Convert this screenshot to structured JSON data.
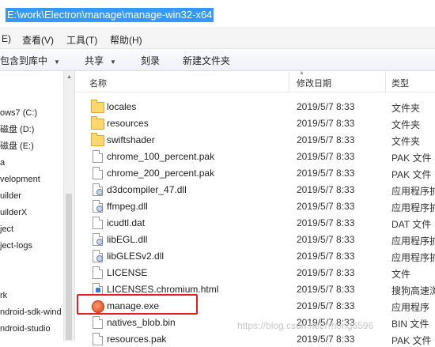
{
  "address_bar": {
    "path": "E:\\work\\Electron\\manage\\manage-win32-x64"
  },
  "menu": [
    {
      "label": "E)"
    },
    {
      "label": "查看(V)"
    },
    {
      "label": "工具(T)"
    },
    {
      "label": "帮助(H)"
    }
  ],
  "toolbar": {
    "include_library": "包含到库中",
    "share": "共享",
    "burn": "刻录",
    "new_folder": "新建文件夹"
  },
  "nav": {
    "items": [
      "ows7 (C:)",
      "磁盘 (D:)",
      "磁盘 (E:)",
      "a",
      "velopment",
      "uilder",
      "uilderX",
      "ject",
      "ject-logs",
      "rk",
      "ndroid-sdk-wind",
      "ndroid-studio"
    ]
  },
  "columns": {
    "name": "名称",
    "modified": "修改日期",
    "type": "类型"
  },
  "files": [
    {
      "name": "locales",
      "date": "2019/5/7 8:33",
      "type": "文件夹",
      "icon": "folder-icon"
    },
    {
      "name": "resources",
      "date": "2019/5/7 8:33",
      "type": "文件夹",
      "icon": "folder-icon"
    },
    {
      "name": "swiftshader",
      "date": "2019/5/7 8:33",
      "type": "文件夹",
      "icon": "folder-icon"
    },
    {
      "name": "chrome_100_percent.pak",
      "date": "2019/5/7 8:33",
      "type": "PAK 文件",
      "icon": "file-icon"
    },
    {
      "name": "chrome_200_percent.pak",
      "date": "2019/5/7 8:33",
      "type": "PAK 文件",
      "icon": "file-icon"
    },
    {
      "name": "d3dcompiler_47.dll",
      "date": "2019/5/7 8:33",
      "type": "应用程序扩",
      "icon": "dll-icon"
    },
    {
      "name": "ffmpeg.dll",
      "date": "2019/5/7 8:33",
      "type": "应用程序扩",
      "icon": "dll-icon"
    },
    {
      "name": "icudtl.dat",
      "date": "2019/5/7 8:33",
      "type": "DAT 文件",
      "icon": "file-icon"
    },
    {
      "name": "libEGL.dll",
      "date": "2019/5/7 8:33",
      "type": "应用程序扩",
      "icon": "dll-icon"
    },
    {
      "name": "libGLESv2.dll",
      "date": "2019/5/7 8:33",
      "type": "应用程序扩",
      "icon": "dll-icon"
    },
    {
      "name": "LICENSE",
      "date": "2019/5/7 8:33",
      "type": "文件",
      "icon": "file-icon"
    },
    {
      "name": "LICENSES.chromium.html",
      "date": "2019/5/7 8:33",
      "type": "搜狗高速浏",
      "icon": "html-icon"
    },
    {
      "name": "manage.exe",
      "date": "2019/5/7 8:33",
      "type": "应用程序",
      "icon": "exe-icon"
    },
    {
      "name": "natives_blob.bin",
      "date": "2019/5/7 8:33",
      "type": "BIN 文件",
      "icon": "file-icon"
    },
    {
      "name": "resources.pak",
      "date": "2019/5/7 8:33",
      "type": "PAK 文件",
      "icon": "file-icon"
    }
  ],
  "watermark": "https://blog.csdn.net/rrhong6596"
}
